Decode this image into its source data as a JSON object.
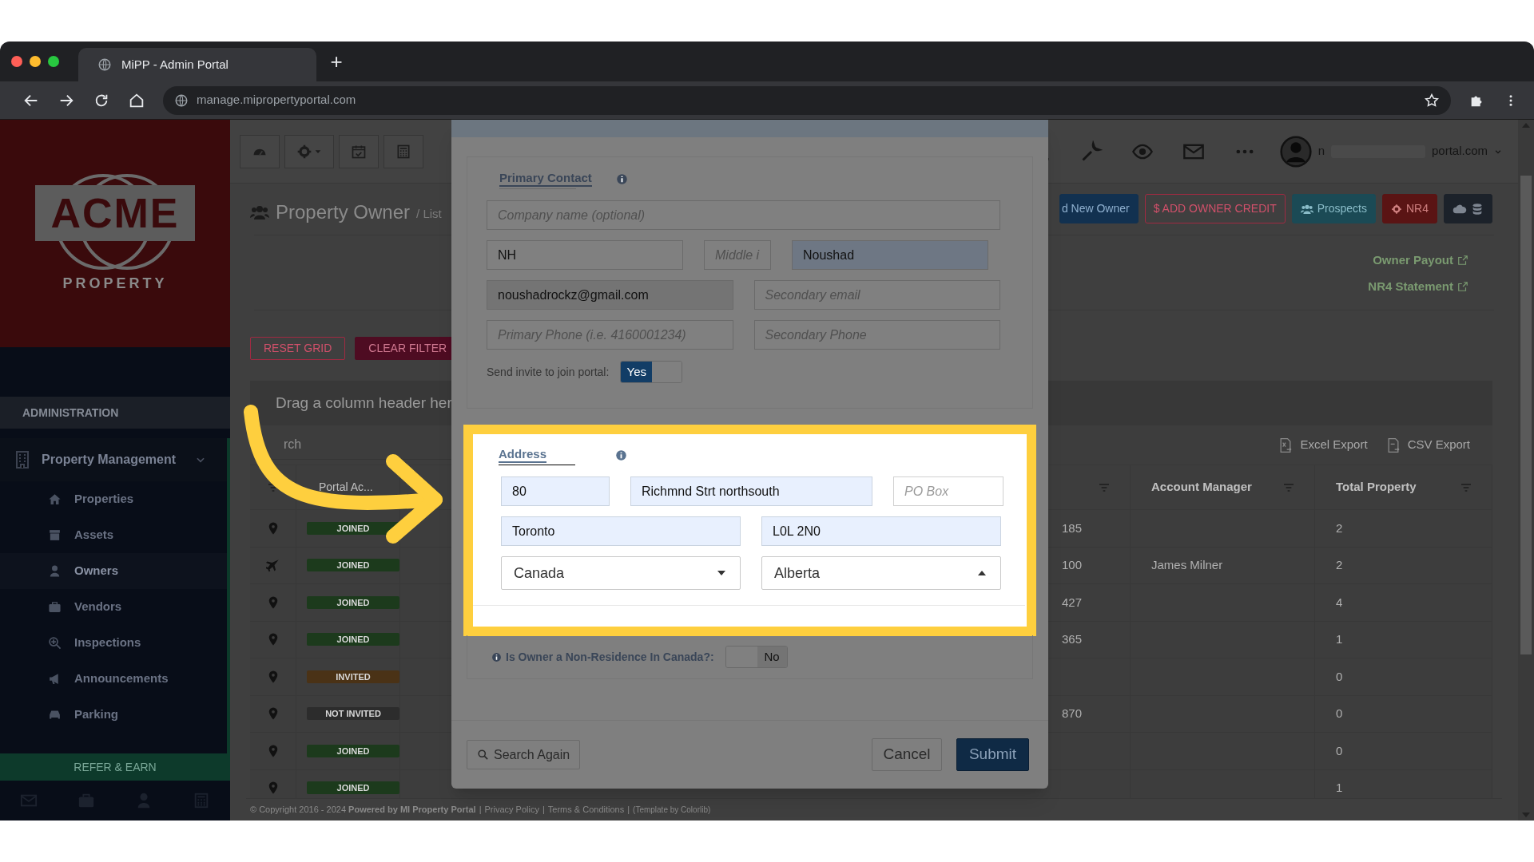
{
  "browser": {
    "tab_title": "MiPP - Admin Portal",
    "new_tab": "+",
    "url": "manage.mipropertyportal.com"
  },
  "sidebar": {
    "logo_text": "ACME",
    "logo_subtext": "PROPERTY",
    "section": "ADMINISTRATION",
    "group": {
      "label": "Property Management",
      "expanded": true
    },
    "items": [
      {
        "label": "Properties",
        "kind": "home",
        "selected": false
      },
      {
        "label": "Assets",
        "kind": "archive",
        "selected": false
      },
      {
        "label": "Owners",
        "kind": "user",
        "selected": true
      },
      {
        "label": "Vendors",
        "kind": "briefcase",
        "selected": false
      },
      {
        "label": "Inspections",
        "kind": "zoom",
        "selected": false
      },
      {
        "label": "Announcements",
        "kind": "megaphone",
        "selected": false
      },
      {
        "label": "Parking",
        "kind": "car",
        "selected": false
      }
    ],
    "refer": "REFER & EARN"
  },
  "topbar": {
    "user_start": "n",
    "user_end": "portal.com"
  },
  "page": {
    "title": "Property Owner",
    "breadcrumb": "/ List",
    "actions": [
      {
        "label": "d New Owner",
        "kind": "primary"
      },
      {
        "label": "$ ADD OWNER CREDIT",
        "kind": "outline"
      },
      {
        "label": "Prospects",
        "kind": "info"
      },
      {
        "label": "NR4",
        "kind": "danger"
      },
      {
        "kind": "upload"
      }
    ],
    "links": [
      "Owner Payout",
      "NR4 Statement"
    ],
    "grid_buttons": [
      {
        "label": "RESET GRID",
        "kind": "outline"
      },
      {
        "label": "CLEAR FILTER",
        "kind": "solid"
      }
    ],
    "group_hint": "Drag a column header her",
    "search_placeholder": "rch",
    "exports": [
      {
        "label": "Excel Export",
        "kind": "excel"
      },
      {
        "label": "CSV Export",
        "kind": "csv"
      }
    ]
  },
  "table": {
    "columns": [
      "Portal Ac...",
      "Account Manager",
      "Total Property"
    ],
    "rows": [
      {
        "kind": "pin",
        "status": "JOINED",
        "color": "#1c3a1c",
        "column_4": "185",
        "total": "2"
      },
      {
        "kind": "plane",
        "status": "JOINED",
        "color": "#1c3a1c",
        "column_4": "100",
        "manager": "James Milner",
        "total": "2"
      },
      {
        "kind": "pin",
        "status": "JOINED",
        "color": "#1c3a1c",
        "column_4": "427",
        "total": "4"
      },
      {
        "kind": "pin",
        "status": "JOINED",
        "color": "#1c3a1c",
        "column_4": "365",
        "total": "1"
      },
      {
        "kind": "pin",
        "status": "INVITED",
        "color": "#4a3216",
        "total": "0"
      },
      {
        "kind": "pin",
        "status": "NOT INVITED",
        "color": "#2c2c2c",
        "column_4": "870",
        "total": "0"
      },
      {
        "kind": "pin",
        "status": "JOINED",
        "color": "#1c3a1c",
        "total": "0"
      },
      {
        "kind": "pin",
        "status": "JOINED",
        "color": "#1c3a1c",
        "total": "1"
      }
    ]
  },
  "footer": {
    "copyright": "© Copyright 2016 - 2024",
    "powered": "Powered by MI Property Portal",
    "separator": "|",
    "links": [
      "Privacy Policy",
      "Terms & Conditions"
    ],
    "template": "(Template by Colorlib)"
  },
  "modal": {
    "primary_contact": {
      "title": "Primary Contact",
      "fields": [
        {
          "placeholder": "Company name (optional)",
          "kind": "plain"
        },
        {
          "value": "NH",
          "kind": "plain"
        },
        {
          "placeholder": "Middle i",
          "kind": "plain"
        },
        {
          "value": "Noushad",
          "kind": "autofill"
        },
        {
          "value": "noushadrockz@gmail.com",
          "kind": "readonly"
        },
        {
          "placeholder": "Secondary email",
          "kind": "plain"
        },
        {
          "placeholder": "Primary Phone (i.e. 4160001234)",
          "kind": "plain"
        },
        {
          "placeholder": "Secondary Phone",
          "kind": "plain"
        }
      ],
      "invite": {
        "label": "Send invite to join portal:",
        "on": true,
        "text": "Yes"
      }
    },
    "address": {
      "title": "Address",
      "highlighted": true,
      "fields": [
        {
          "value": "80",
          "kind": "autofill"
        },
        {
          "value": "Richmnd Strt northsouth",
          "kind": "autofill"
        },
        {
          "placeholder": "PO Box",
          "kind": "plain"
        },
        {
          "value": "Toronto",
          "kind": "autofill"
        },
        {
          "value": "L0L 2N0",
          "kind": "autofill"
        }
      ],
      "selects": [
        {
          "value": "Canada",
          "expanded": false
        },
        {
          "value": "Alberta",
          "expanded": true
        }
      ]
    },
    "non_resident": {
      "label": "Is Owner a Non-Residence In Canada?:",
      "on": false,
      "text": "No"
    },
    "search_again": "Search Again",
    "cancel": "Cancel",
    "submit": "Submit"
  }
}
